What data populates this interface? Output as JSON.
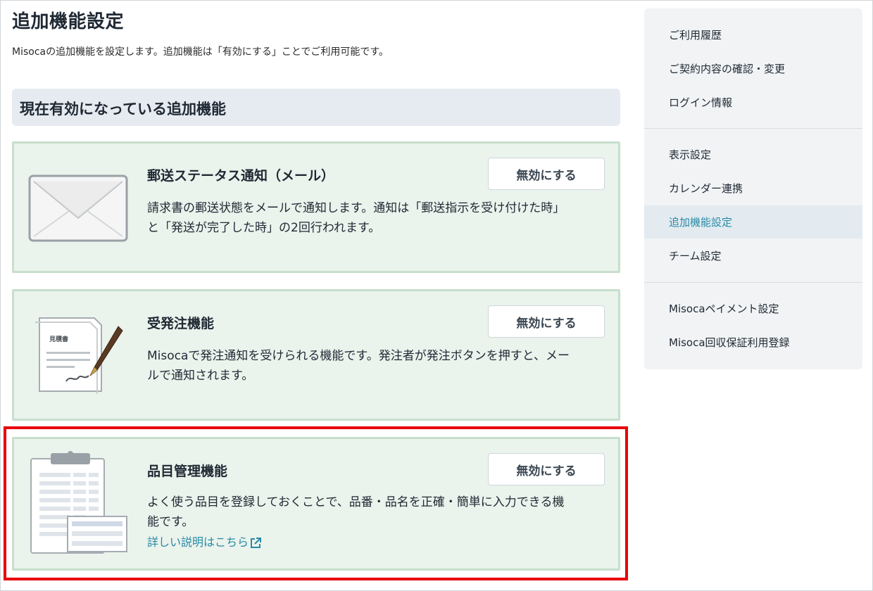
{
  "page": {
    "title": "追加機能設定",
    "description": "Misocaの追加機能を設定します。追加機能は「有効にする」ことでご利用可能です。"
  },
  "section": {
    "title": "現在有効になっている追加機能"
  },
  "features": [
    {
      "title": "郵送ステータス通知（メール）",
      "description_line1": "請求書の郵送状態をメールで通知します。通知は「郵送指示を受け付けた時」",
      "description_line2": "と「発送が完了した時」の2回行われます。",
      "button_label": "無効にする",
      "icon": "envelope-icon"
    },
    {
      "title": "受発注機能",
      "description_line1": "Misocaで発注通知を受けられる機能です。発注者が発注ボタンを押すと、メー",
      "description_line2": "ルで通知されます。",
      "button_label": "無効にする",
      "icon": "estimate-document-icon",
      "document_label": "見積書"
    },
    {
      "title": "品目管理機能",
      "description_line1": "よく使う品目を登録しておくことで、品番・品名を正確・簡単に入力できる機",
      "description_line2": "能です。",
      "button_label": "無効にする",
      "link_label": "詳しい説明はこちら",
      "icon": "clipboard-list-icon"
    }
  ],
  "sidebar": {
    "items": [
      {
        "label": "ご利用履歴"
      },
      {
        "label": "ご契約内容の確認・変更"
      },
      {
        "label": "ログイン情報"
      },
      {
        "label": "表示設定"
      },
      {
        "label": "カレンダー連携"
      },
      {
        "label": "追加機能設定",
        "active": true
      },
      {
        "label": "チーム設定"
      },
      {
        "label": "Misocaペイメント設定"
      },
      {
        "label": "Misoca回収保証利用登録"
      }
    ]
  },
  "colors": {
    "card_background": "#eaf3ec",
    "card_border": "#c7dfcc",
    "section_header_background": "#e6eaf1",
    "link": "#2a8aa6",
    "highlight_border": "#e8000b",
    "sidebar_background": "#f1f3f5"
  }
}
